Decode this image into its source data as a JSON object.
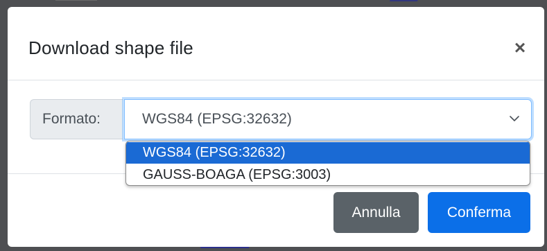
{
  "modal": {
    "title": "Download shape file",
    "close_label": "×"
  },
  "form": {
    "format_label": "Formato:",
    "selected_value": "WGS84 (EPSG:32632)",
    "options": [
      "WGS84 (EPSG:32632)",
      "GAUSS-BOAGA (EPSG:3003)"
    ]
  },
  "footer": {
    "cancel_label": "Annulla",
    "confirm_label": "Conferma"
  },
  "colors": {
    "primary": "#0b6fe8",
    "secondary": "#5a6268",
    "option_highlight": "#1a6ad4"
  },
  "icons": {
    "close": "close-icon",
    "chevron": "chevron-down-icon"
  }
}
